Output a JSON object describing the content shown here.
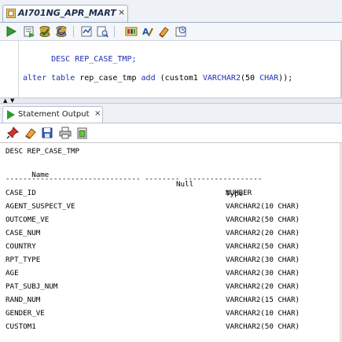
{
  "tab": {
    "title": "AI701NG_APR_MART",
    "close": "×"
  },
  "toolbar": {
    "icons": [
      "run-statement-icon",
      "run-script-icon",
      "commit-icon",
      "rollback-icon",
      "cancel-icon",
      "sql-tuning-icon",
      "autotrace-icon",
      "explain-plan-icon",
      "format-icon",
      "clear-icon",
      "history-icon"
    ]
  },
  "editor": {
    "line1": "DESC REP_CASE_TMP;",
    "line2_kw1": "alter table",
    "line2_txt1": " rep_case_tmp ",
    "line2_kw2": "add",
    "line2_txt2": " (custom1 ",
    "line2_kw3": "VARCHAR2",
    "line2_txt3": "(50 ",
    "line2_kw4": "CHAR",
    "line2_txt4": "));"
  },
  "output_tab": {
    "title": "Statement Output",
    "close": "×"
  },
  "output_toolbar": {
    "icons": [
      "pin-icon",
      "eraser-icon",
      "save-icon",
      "print-icon",
      "open-file-icon"
    ]
  },
  "output": {
    "command": "DESC REP_CASE_TMP",
    "headers": {
      "name": "Name",
      "null": "Null",
      "type": "Type"
    },
    "separator": "------------------------------- -------- ------------------",
    "rows": [
      {
        "name": "CASE_ID",
        "null": "",
        "type": "NUMBER"
      },
      {
        "name": "AGENT_SUSPECT_VE",
        "null": "",
        "type": "VARCHAR2(10 CHAR)"
      },
      {
        "name": "OUTCOME_VE",
        "null": "",
        "type": "VARCHAR2(50 CHAR)"
      },
      {
        "name": "CASE_NUM",
        "null": "",
        "type": "VARCHAR2(20 CHAR)"
      },
      {
        "name": "COUNTRY",
        "null": "",
        "type": "VARCHAR2(50 CHAR)"
      },
      {
        "name": "RPT_TYPE",
        "null": "",
        "type": "VARCHAR2(30 CHAR)"
      },
      {
        "name": "AGE",
        "null": "",
        "type": "VARCHAR2(30 CHAR)"
      },
      {
        "name": "PAT_SUBJ_NUM",
        "null": "",
        "type": "VARCHAR2(20 CHAR)"
      },
      {
        "name": "RAND_NUM",
        "null": "",
        "type": "VARCHAR2(15 CHAR)"
      },
      {
        "name": "GENDER_VE",
        "null": "",
        "type": "VARCHAR2(10 CHAR)"
      },
      {
        "name": "CUSTOM1",
        "null": "",
        "type": "VARCHAR2(50 CHAR)"
      }
    ]
  }
}
